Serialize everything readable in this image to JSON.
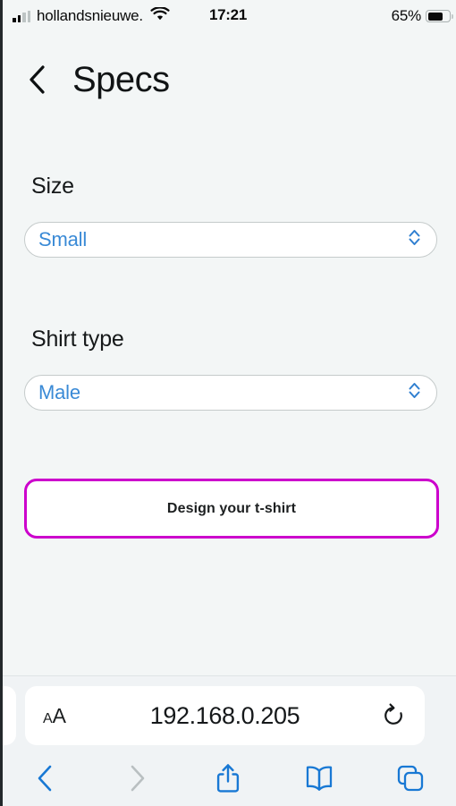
{
  "status_bar": {
    "carrier": "hollandsnieuwe.",
    "time": "17:21",
    "battery_percent": "65%",
    "signal_icon": "signal-bars-icon",
    "wifi_icon": "wifi-icon",
    "battery_icon": "battery-icon",
    "battery_level": 65
  },
  "page": {
    "back_icon": "back-chevron-icon",
    "title": "Specs",
    "fields": [
      {
        "label": "Size",
        "value": "Small",
        "options": [
          "Small"
        ],
        "arrows_icon": "select-updown-chevron-icon"
      },
      {
        "label": "Shirt type",
        "value": "Male",
        "options": [
          "Male"
        ],
        "arrows_icon": "select-updown-chevron-icon"
      }
    ],
    "primary_button": {
      "label": "Design your t-shirt",
      "border_color": "#cc00cc",
      "text_color": "#1c1f20",
      "background": "#ffffff"
    },
    "background_color": "#f3f6f6",
    "select_text_color": "#3a8ad6"
  },
  "browser": {
    "text_size_button": {
      "small_a": "A",
      "big_a": "A",
      "name": "aa-text-size-button"
    },
    "url": "192.168.0.205",
    "reload_icon": "reload-icon",
    "toolbar": [
      {
        "icon": "back-icon",
        "label": "Back",
        "enabled": true
      },
      {
        "icon": "forward-icon",
        "label": "Forward",
        "enabled": false
      },
      {
        "icon": "share-icon",
        "label": "Share",
        "enabled": true
      },
      {
        "icon": "bookmarks-icon",
        "label": "Bookmarks",
        "enabled": true
      },
      {
        "icon": "tabs-icon",
        "label": "Tabs",
        "enabled": true
      }
    ],
    "accent_color": "#1878d4",
    "disabled_color": "#b9bfc1"
  }
}
